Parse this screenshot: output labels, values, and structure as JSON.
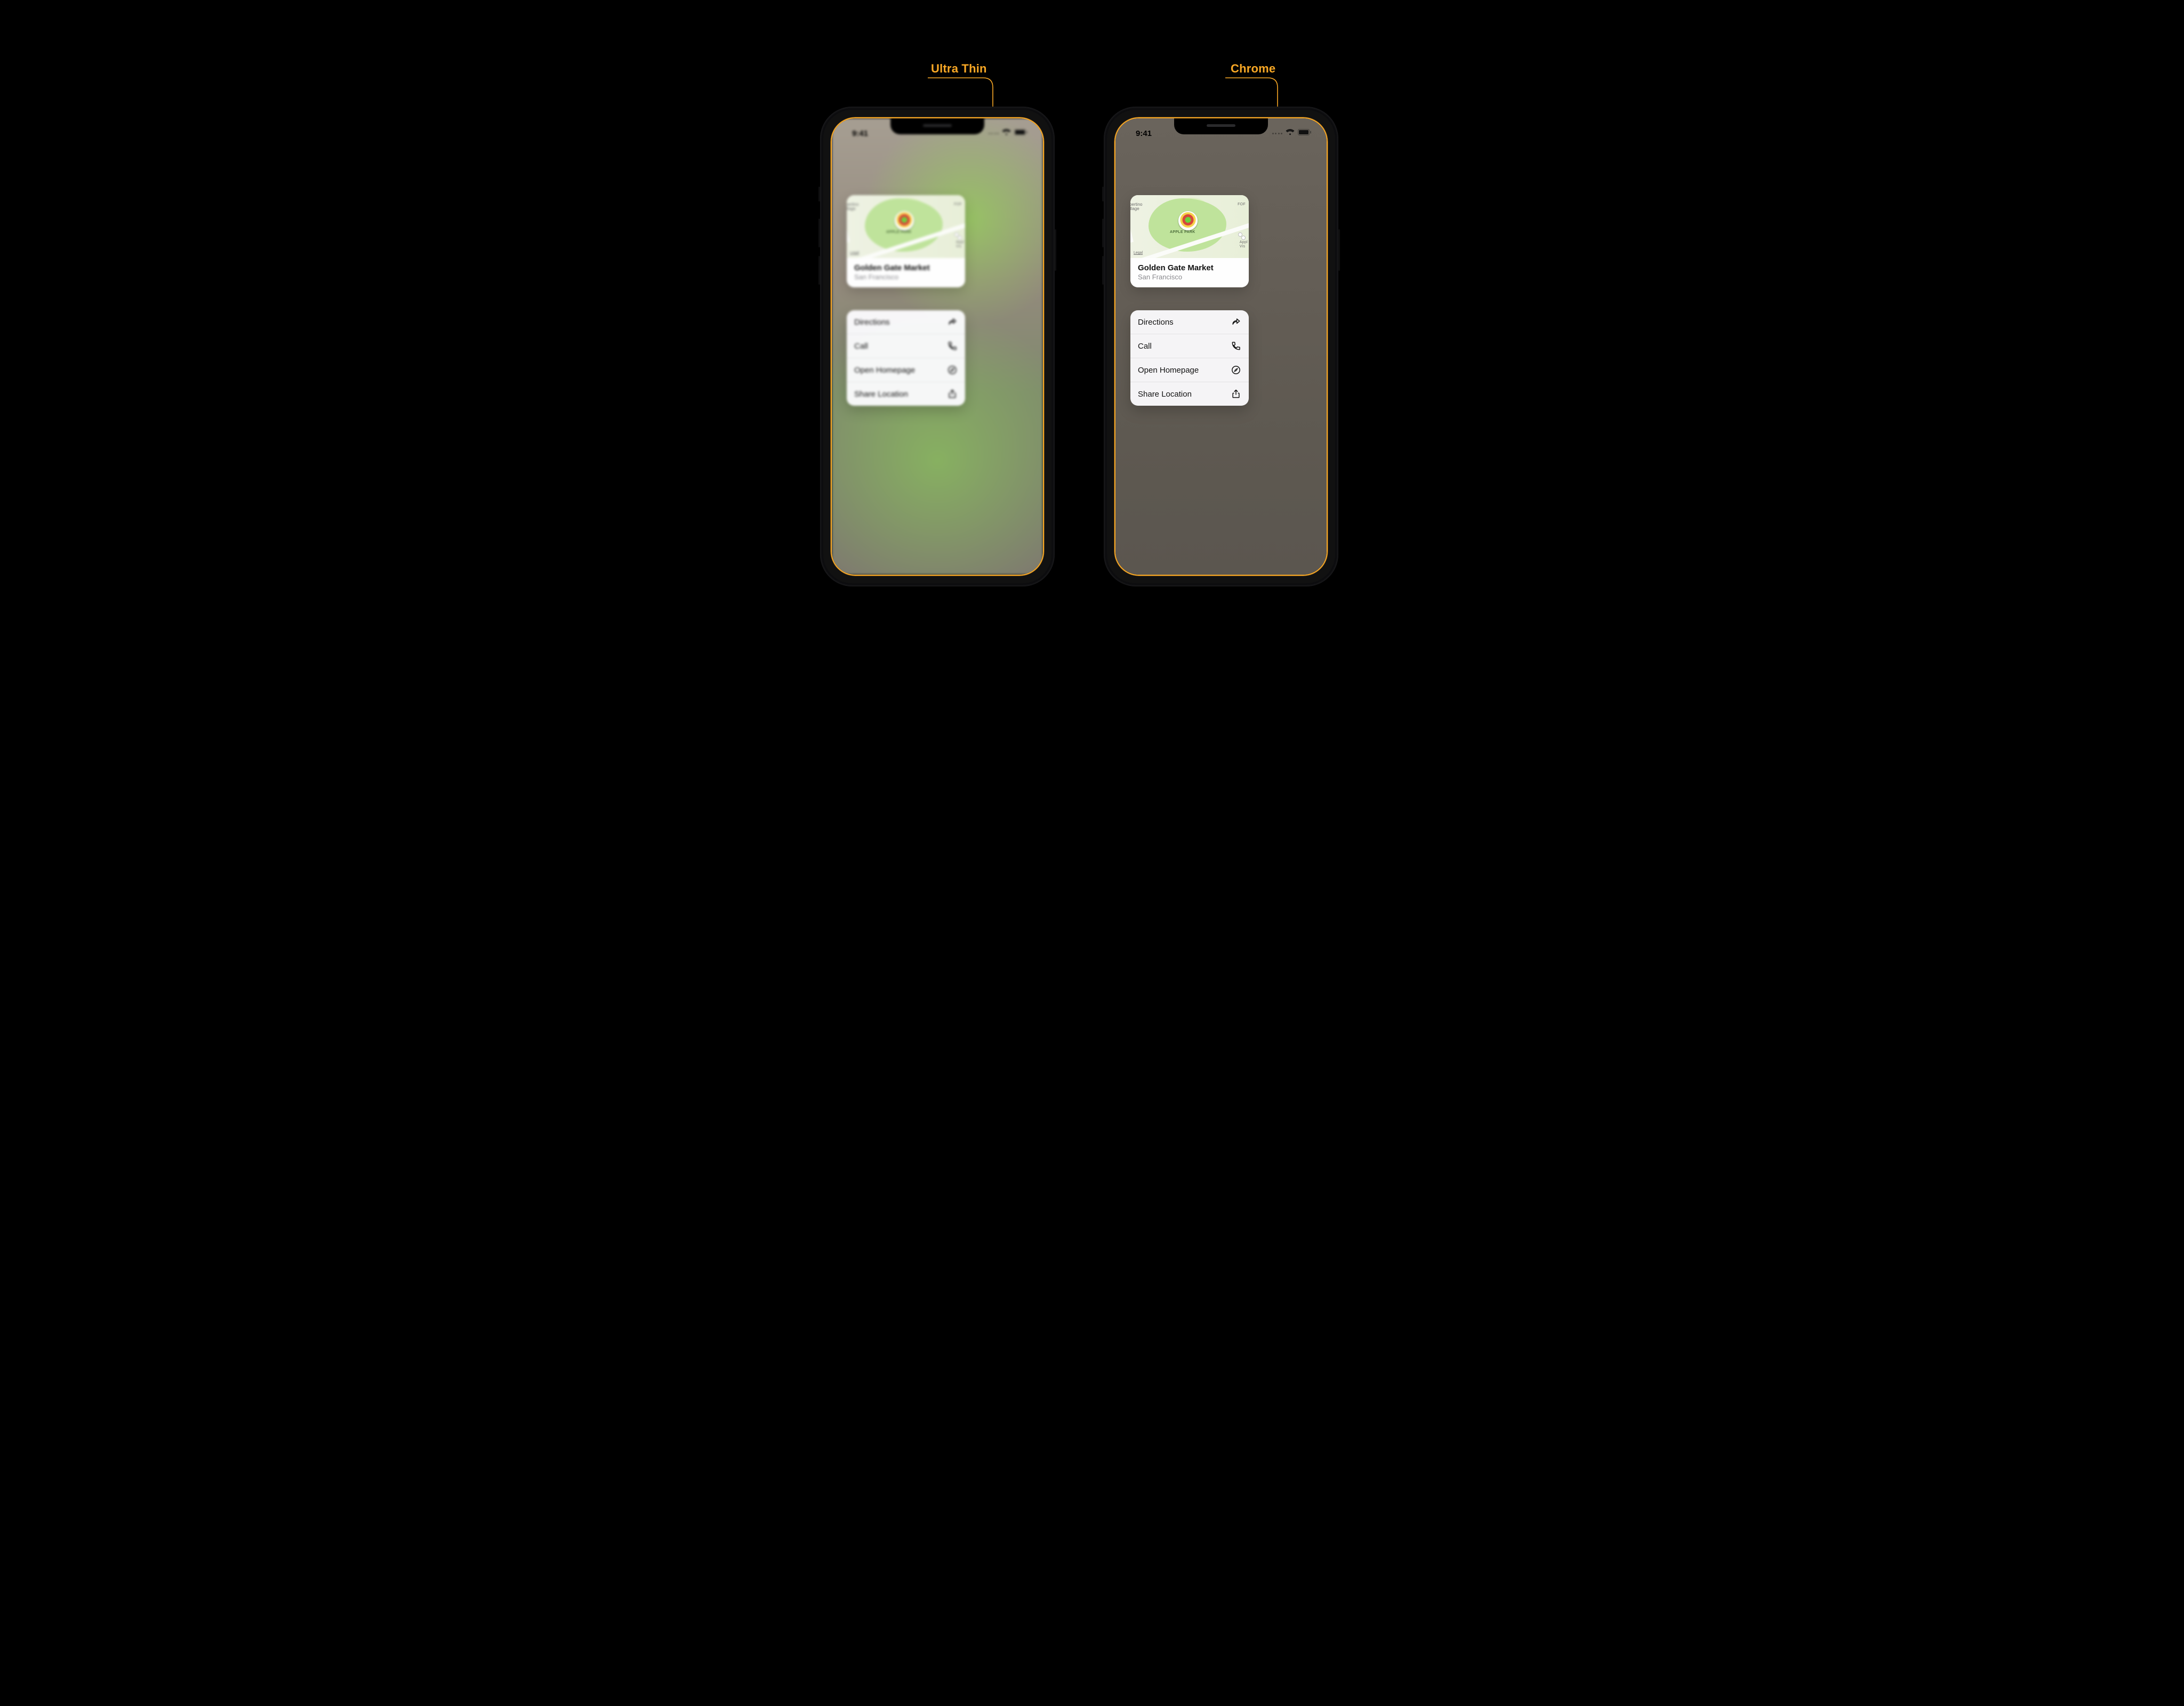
{
  "annotations": {
    "left_label": "Ultra Thin",
    "right_label": "Chrome"
  },
  "status": {
    "time": "9:41"
  },
  "place_card": {
    "title": "Golden Gate Market",
    "subtitle": "San Francisco",
    "map": {
      "poi_label": "APPLE PARK",
      "legal_label": "Legal",
      "label_cupertino_1": "pertino",
      "label_cupertino_2": "illage",
      "label_for": "FOF",
      "label_apple_vis_1": "Appl",
      "label_apple_vis_2": "Vis"
    }
  },
  "menu": {
    "items": [
      {
        "label": "Directions",
        "icon": "arrow-redo-icon"
      },
      {
        "label": "Call",
        "icon": "phone-icon"
      },
      {
        "label": "Open Homepage",
        "icon": "compass-icon"
      },
      {
        "label": "Share Location",
        "icon": "share-icon"
      }
    ]
  },
  "colors": {
    "accent": "#f9a825"
  }
}
